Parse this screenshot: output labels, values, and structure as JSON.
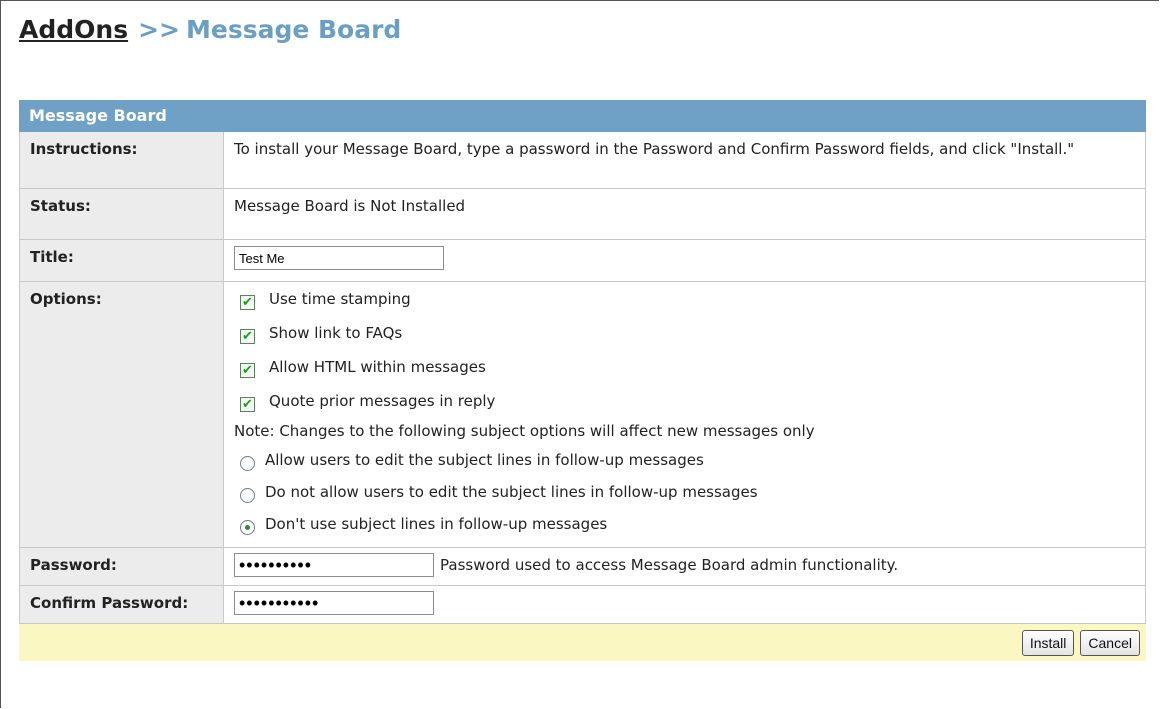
{
  "breadcrumb": {
    "parent": "AddOns",
    "separator": ">>",
    "current": "Message Board"
  },
  "panel": {
    "header": "Message Board",
    "rows": {
      "instructions": {
        "label": "Instructions:",
        "value": "To install your Message Board, type a password in the Password and Confirm Password fields, and click \"Install.\""
      },
      "status": {
        "label": "Status:",
        "value": "Message Board is Not Installed"
      },
      "title": {
        "label": "Title:",
        "value": "Test Me"
      },
      "options": {
        "label": "Options:",
        "checkboxes": [
          {
            "label": "Use time stamping",
            "checked": true
          },
          {
            "label": "Show link to FAQs",
            "checked": true
          },
          {
            "label": "Allow HTML within messages",
            "checked": true
          },
          {
            "label": "Quote prior messages in reply",
            "checked": true
          }
        ],
        "note": "Note: Changes to the following subject options will affect new messages only",
        "radios": [
          {
            "label": "Allow users to edit the subject lines in follow-up messages",
            "selected": false
          },
          {
            "label": "Do not allow users to edit the subject lines in follow-up messages",
            "selected": false
          },
          {
            "label": "Don't use subject lines in follow-up messages",
            "selected": true
          }
        ]
      },
      "password": {
        "label": "Password:",
        "value": "••••••••••",
        "help": "Password used to access Message Board admin functionality."
      },
      "confirm_password": {
        "label": "Confirm Password:",
        "value": "•••••••••••"
      }
    }
  },
  "footer": {
    "install_label": "Install",
    "cancel_label": "Cancel"
  },
  "colors": {
    "header_bg": "#6fa0c5",
    "breadcrumb_accent": "#6a9ec2",
    "label_bg": "#ececec",
    "footer_bg": "#fbf7c2"
  }
}
